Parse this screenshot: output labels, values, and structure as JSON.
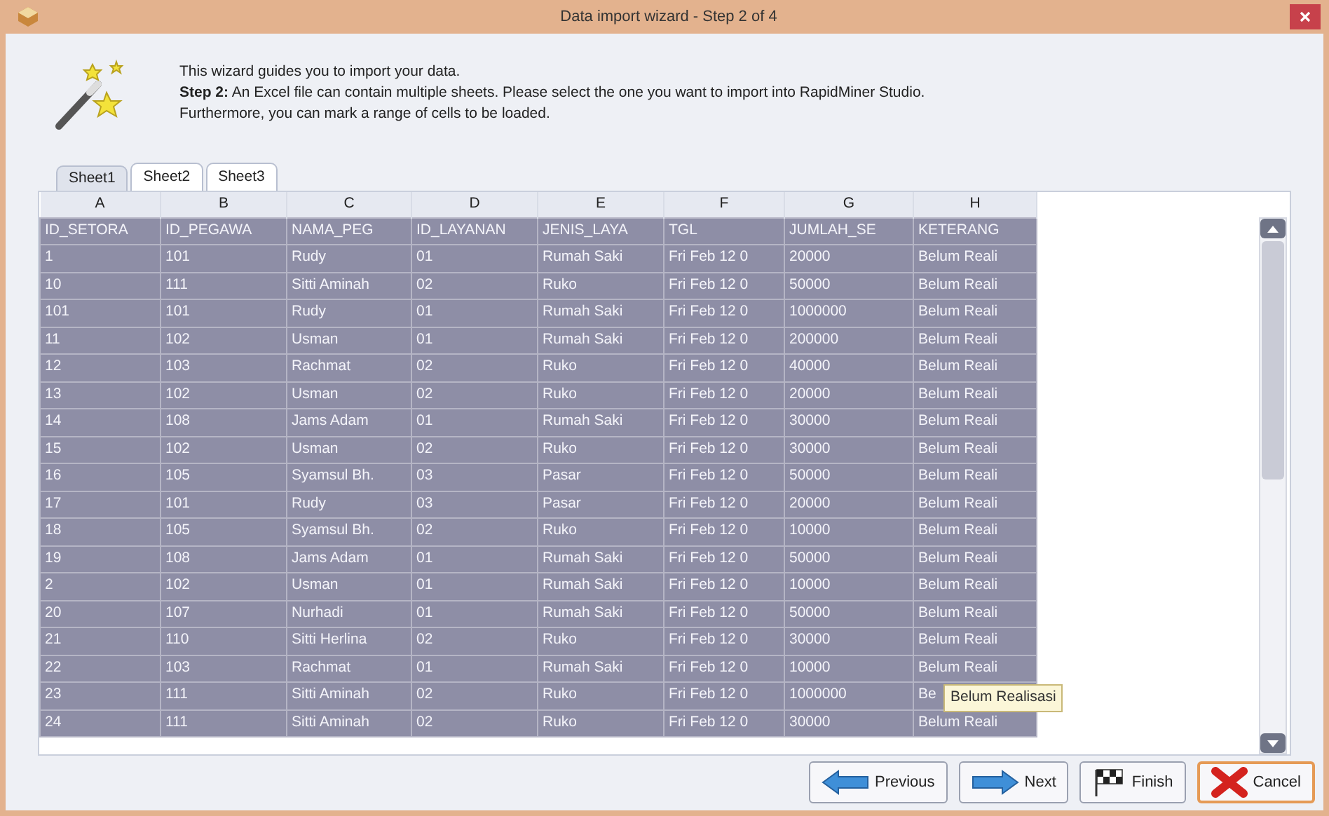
{
  "window": {
    "title": "Data import wizard - Step 2 of 4"
  },
  "intro": {
    "line1": "This wizard guides you to import your data.",
    "line2": "**Step 2:** An Excel file can contain multiple sheets. Please select the one you want to import into RapidMiner Studio.",
    "line3": "Furthermore, you can mark a range of cells to be loaded."
  },
  "tabs": [
    {
      "label": "Sheet1",
      "selected": true
    },
    {
      "label": "Sheet2",
      "selected": false
    },
    {
      "label": "Sheet3",
      "selected": false
    }
  ],
  "table": {
    "column_letters": [
      "A",
      "B",
      "C",
      "D",
      "E",
      "F",
      "G",
      "H"
    ],
    "rows": [
      [
        "ID_SETORA",
        "ID_PEGAWA",
        "NAMA_PEG",
        "ID_LAYANAN",
        "JENIS_LAYA",
        "TGL",
        "JUMLAH_SE",
        "KETERANG"
      ],
      [
        "1",
        "101",
        "Rudy",
        "01",
        "Rumah Saki",
        "Fri Feb 12 0",
        "20000",
        "Belum Reali"
      ],
      [
        "10",
        "111",
        "Sitti Aminah",
        "02",
        "Ruko",
        "Fri Feb 12 0",
        "50000",
        "Belum Reali"
      ],
      [
        "101",
        "101",
        "Rudy",
        "01",
        "Rumah Saki",
        "Fri Feb 12 0",
        "1000000",
        "Belum Reali"
      ],
      [
        "11",
        "102",
        "Usman",
        "01",
        "Rumah Saki",
        "Fri Feb 12 0",
        "200000",
        "Belum Reali"
      ],
      [
        "12",
        "103",
        "Rachmat",
        "02",
        "Ruko",
        "Fri Feb 12 0",
        "40000",
        "Belum Reali"
      ],
      [
        "13",
        "102",
        "Usman",
        "02",
        "Ruko",
        "Fri Feb 12 0",
        "20000",
        "Belum Reali"
      ],
      [
        "14",
        "108",
        "Jams Adam",
        "01",
        "Rumah Saki",
        "Fri Feb 12 0",
        "30000",
        "Belum Reali"
      ],
      [
        "15",
        "102",
        "Usman",
        "02",
        "Ruko",
        "Fri Feb 12 0",
        "30000",
        "Belum Reali"
      ],
      [
        "16",
        "105",
        "Syamsul Bh.",
        "03",
        "Pasar",
        "Fri Feb 12 0",
        "50000",
        "Belum Reali"
      ],
      [
        "17",
        "101",
        "Rudy",
        "03",
        "Pasar",
        "Fri Feb 12 0",
        "20000",
        "Belum Reali"
      ],
      [
        "18",
        "105",
        "Syamsul Bh.",
        "02",
        "Ruko",
        "Fri Feb 12 0",
        "10000",
        "Belum Reali"
      ],
      [
        "19",
        "108",
        "Jams Adam",
        "01",
        "Rumah Saki",
        "Fri Feb 12 0",
        "50000",
        "Belum Reali"
      ],
      [
        "2",
        "102",
        "Usman",
        "01",
        "Rumah Saki",
        "Fri Feb 12 0",
        "10000",
        "Belum Reali"
      ],
      [
        "20",
        "107",
        "Nurhadi",
        "01",
        "Rumah Saki",
        "Fri Feb 12 0",
        "50000",
        "Belum Reali"
      ],
      [
        "21",
        "110",
        "Sitti Herlina",
        "02",
        "Ruko",
        "Fri Feb 12 0",
        "30000",
        "Belum Reali"
      ],
      [
        "22",
        "103",
        "Rachmat",
        "01",
        "Rumah Saki",
        "Fri Feb 12 0",
        "10000",
        "Belum Reali"
      ],
      [
        "23",
        "111",
        "Sitti Aminah",
        "02",
        "Ruko",
        "Fri Feb 12 0",
        "1000000",
        "Be"
      ],
      [
        "24",
        "111",
        "Sitti Aminah",
        "02",
        "Ruko",
        "Fri Feb 12 0",
        "30000",
        "Belum Reali"
      ]
    ]
  },
  "tooltip": "Belum Realisasi",
  "buttons": [
    {
      "label": "Previous",
      "kind": "previous",
      "focused": false
    },
    {
      "label": "Next",
      "kind": "next",
      "focused": false
    },
    {
      "label": "Finish",
      "kind": "finish",
      "focused": false
    },
    {
      "label": "Cancel",
      "kind": "cancel",
      "focused": true
    }
  ]
}
